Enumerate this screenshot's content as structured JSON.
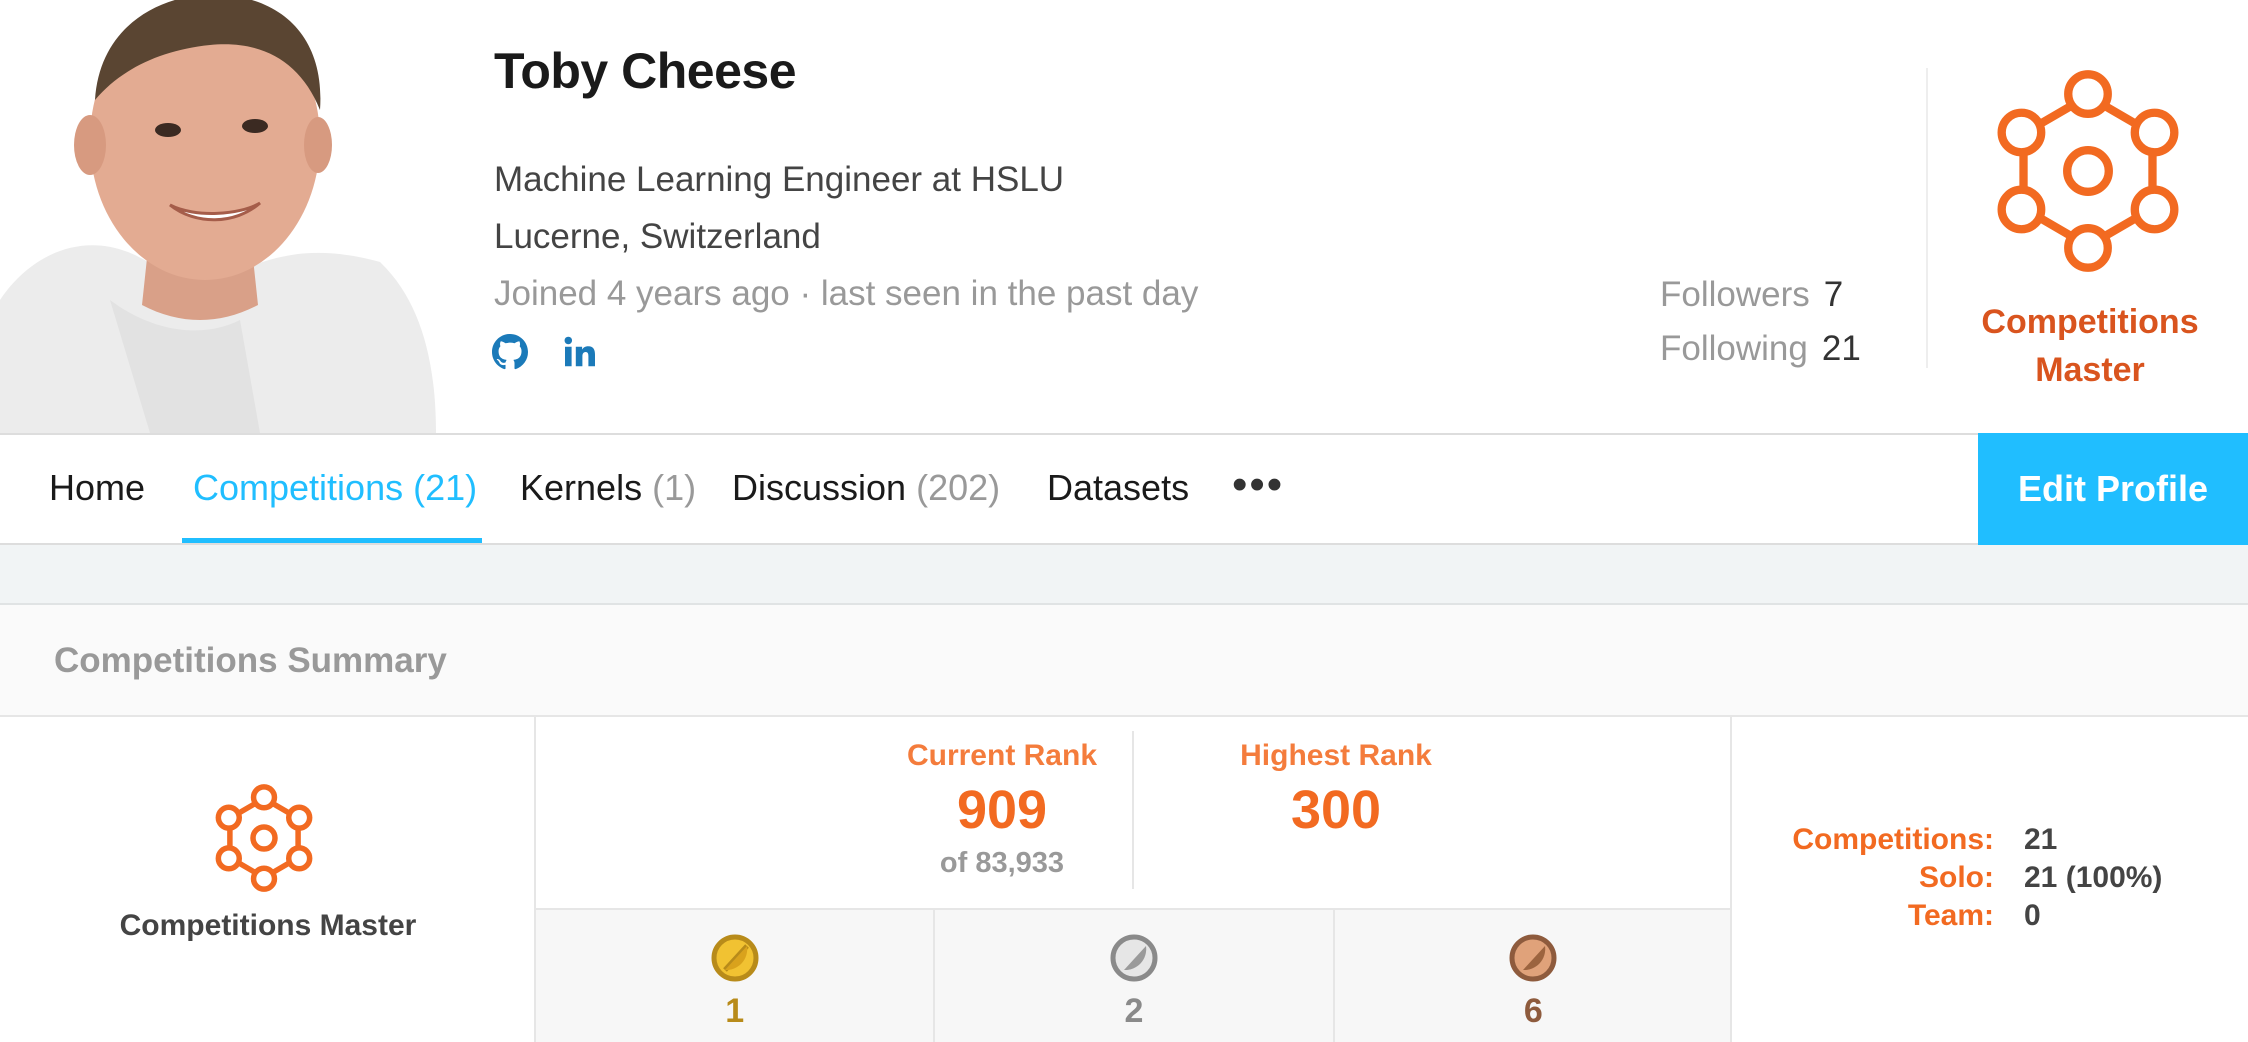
{
  "profile": {
    "name": "Toby Cheese",
    "occupation": "Machine Learning Engineer at HSLU",
    "location": "Lucerne, Switzerland",
    "joined": "Joined 4 years ago · last seen in the past day",
    "social": [
      "github-icon",
      "linkedin-icon"
    ]
  },
  "follow": {
    "followers_label": "Followers",
    "followers_count": "7",
    "following_label": "Following",
    "following_count": "21"
  },
  "tier": {
    "label": "Competitions Master",
    "color": "#f26a21"
  },
  "tabs": [
    {
      "label": "Home",
      "count": ""
    },
    {
      "label": "Competitions",
      "count": "(21)",
      "active": true
    },
    {
      "label": "Kernels",
      "count": "(1)"
    },
    {
      "label": "Discussion",
      "count": "(202)"
    },
    {
      "label": "Datasets",
      "count": ""
    }
  ],
  "more_label": "•••",
  "edit_profile_label": "Edit Profile",
  "summary": {
    "title": "Competitions Summary",
    "tier_label": "Competitions Master",
    "current_rank_label": "Current Rank",
    "current_rank": "909",
    "rank_of": "of 83,933",
    "highest_rank_label": "Highest Rank",
    "highest_rank": "300",
    "medals": [
      {
        "type": "gold",
        "count": "1",
        "color": "#b88b1a"
      },
      {
        "type": "silver",
        "count": "2",
        "color": "#8a8a8a"
      },
      {
        "type": "bronze",
        "count": "6",
        "color": "#8e5b3d"
      }
    ],
    "stats": [
      {
        "label": "Competitions:",
        "value": "21"
      },
      {
        "label": "Solo:",
        "value": "21 (100%)"
      },
      {
        "label": "Team:",
        "value": "0"
      }
    ]
  },
  "colors": {
    "accent": "#20beff",
    "tier_orange": "#f26a21",
    "tier_label_orange": "#d9541e"
  }
}
